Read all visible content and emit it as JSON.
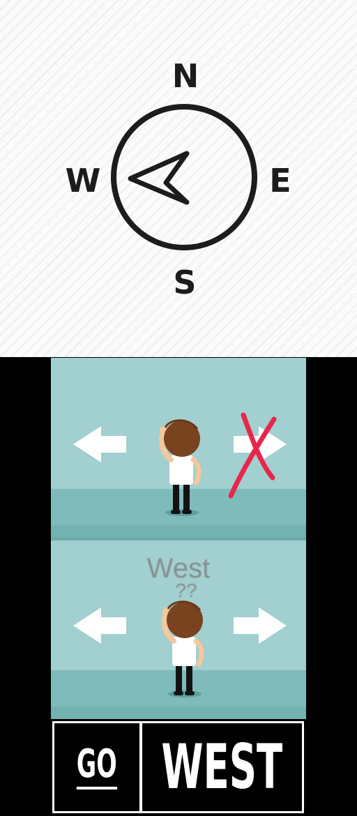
{
  "compass": {
    "north": "N",
    "south": "S",
    "west": "W",
    "east": "E",
    "needle_points_to": "west",
    "icons": [
      "compass-circle-icon",
      "compass-needle-icon"
    ]
  },
  "cartoon": {
    "top_scene": {
      "icons": [
        "left-arrow-icon",
        "right-arrow-icon",
        "red-cross-mark-icon",
        "confused-man-icon"
      ]
    },
    "bottom_scene": {
      "caption": "West",
      "question_marks": "??",
      "icons": [
        "left-arrow-icon",
        "right-arrow-icon",
        "confused-man-icon"
      ]
    },
    "colors": {
      "background": "#a2cfcf",
      "floor": "#7fbbba",
      "cross_mark": "#e8264c",
      "hair": "#7a4320"
    }
  },
  "banner": {
    "word_left": "GO",
    "word_right": "WEST"
  }
}
